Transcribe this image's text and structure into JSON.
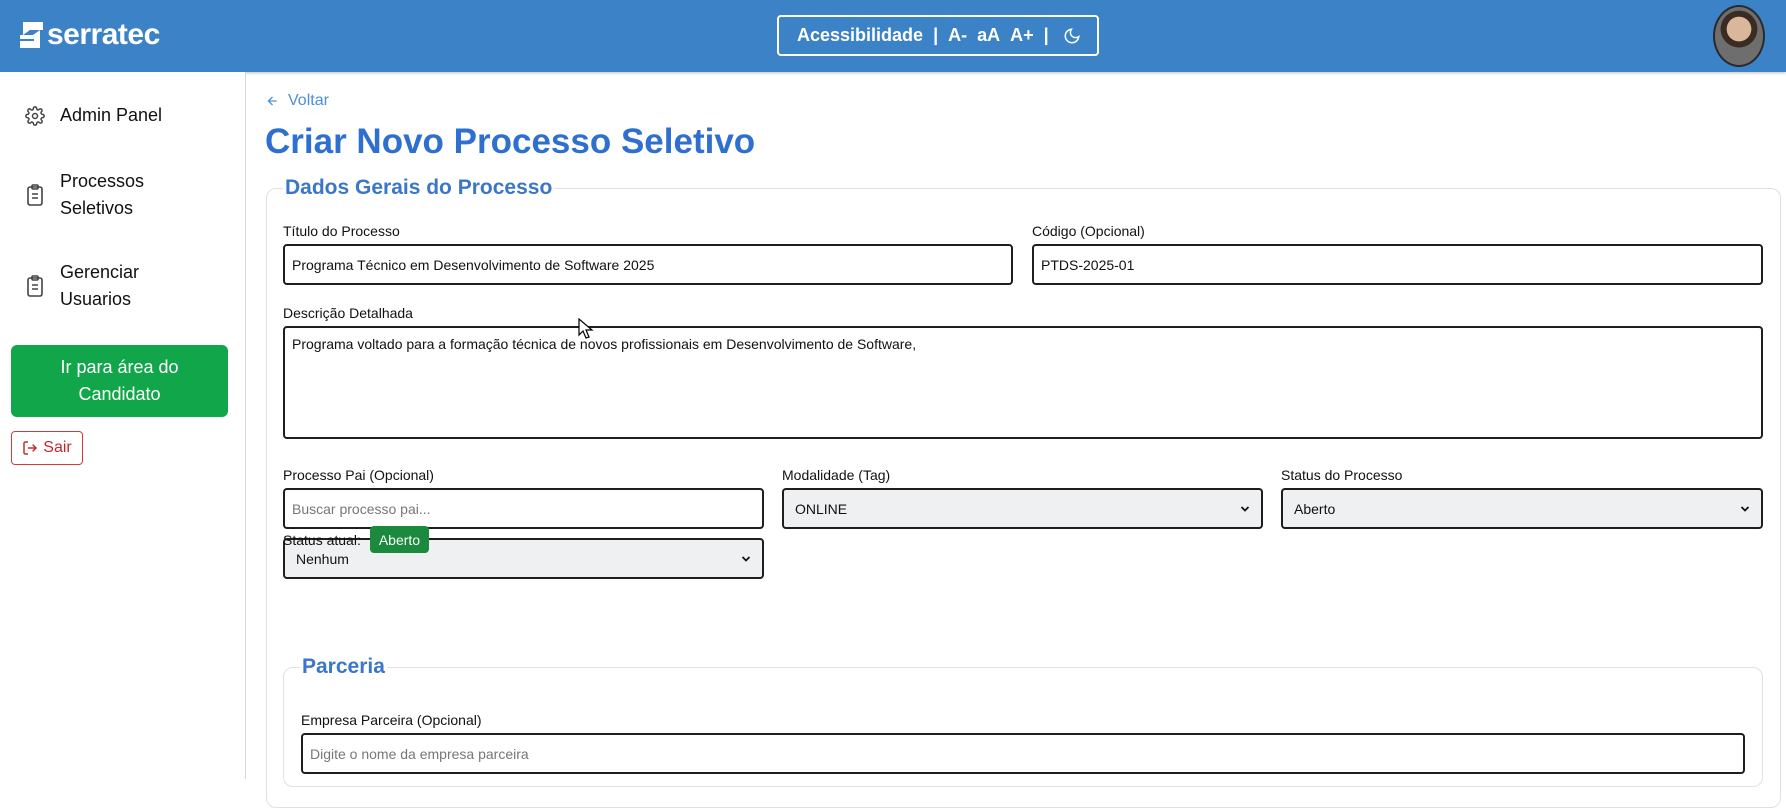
{
  "header": {
    "brand": "serratec",
    "accessibility": {
      "label": "Acessibilidade",
      "sep1": "|",
      "decrease": "A-",
      "reset": "aA",
      "increase": "A+",
      "sep2": "|"
    }
  },
  "sidebar": {
    "items": [
      {
        "label": "Admin Panel",
        "icon": "gear-icon"
      },
      {
        "label": "Processos Seletivos",
        "icon": "clipboard-icon"
      },
      {
        "label": "Gerenciar Usuarios",
        "icon": "clipboard-icon"
      }
    ],
    "cta_label": "Ir para área do Candidato",
    "logout_label": "Sair"
  },
  "main": {
    "back_label": "Voltar",
    "title": "Criar Novo Processo Seletivo",
    "section_general": "Dados Gerais do Processo",
    "fields": {
      "titulo_label": "Título do Processo",
      "titulo_value": "Programa Técnico em Desenvolvimento de Software 2025",
      "codigo_label": "Código (Opcional)",
      "codigo_value": "PTDS-2025-01",
      "descricao_label": "Descrição Detalhada",
      "descricao_value": "Programa voltado para a formação técnica de novos profissionais em Desenvolvimento de Software,",
      "pai_label": "Processo Pai (Opcional)",
      "pai_placeholder": "Buscar processo pai...",
      "pai_select_value": "Nenhum",
      "modalidade_label": "Modalidade (Tag)",
      "modalidade_value": "ONLINE",
      "status_label": "Status do Processo",
      "status_value": "Aberto"
    },
    "status_current_label": "Status atual:",
    "status_current_badge": "Aberto",
    "section_partner": "Parceria",
    "partner_label": "Empresa Parceira (Opcional)",
    "partner_placeholder": "Digite o nome da empresa parceira"
  },
  "colors": {
    "header_bg": "#3c82c6",
    "accent_blue": "#2f6fcf",
    "cta_green": "#12a64a",
    "badge_green": "#1b8a3c",
    "logout_red": "#c62828"
  }
}
